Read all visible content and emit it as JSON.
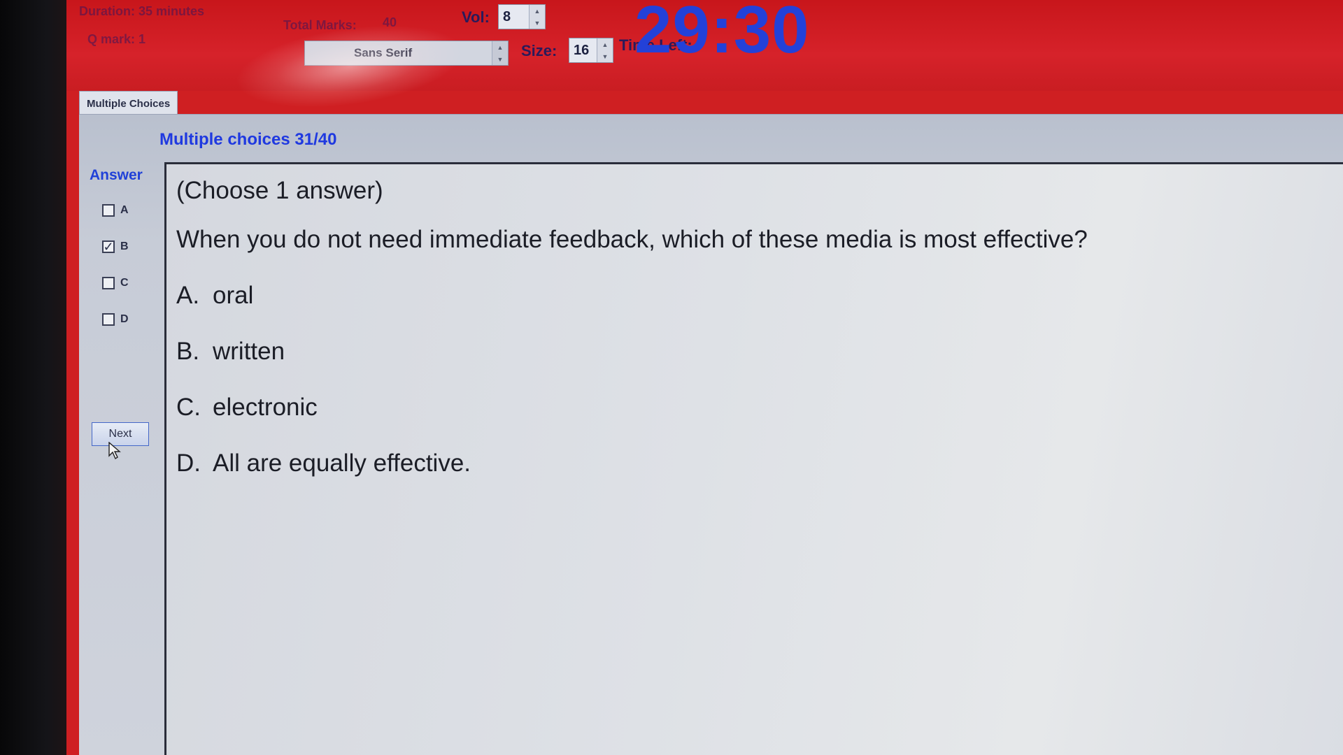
{
  "header": {
    "duration_text": "Duration: 35 minutes",
    "question_mark_text": "Q mark: 1",
    "total_marks_label": "Total Marks:",
    "total_marks_value": "40",
    "volume_label": "Vol:",
    "volume_value": "8",
    "font_value": "Sans Serif",
    "size_label": "Size:",
    "size_value": "16",
    "time_left_label": "Time Left:",
    "timer": "29:30"
  },
  "tab": {
    "label": "Multiple Choices"
  },
  "section": {
    "title": "Multiple choices 31/40"
  },
  "answer_panel": {
    "label": "Answer",
    "options": [
      {
        "letter": "A",
        "checked": false,
        "mark": ""
      },
      {
        "letter": "B",
        "checked": true,
        "mark": "✓"
      },
      {
        "letter": "C",
        "checked": false,
        "mark": ""
      },
      {
        "letter": "D",
        "checked": false,
        "mark": ""
      }
    ],
    "next_label": "Next"
  },
  "question": {
    "instruction": "(Choose 1 answer)",
    "text": "When you do not need immediate feedback, which of these media is most effective?",
    "choices": [
      {
        "letter": "A.",
        "text": "oral"
      },
      {
        "letter": "B.",
        "text": "written"
      },
      {
        "letter": "C.",
        "text": "electronic"
      },
      {
        "letter": "D.",
        "text": "All are equally effective."
      }
    ]
  },
  "colors": {
    "header_red": "#d6222a",
    "timer_blue": "#2341d8",
    "title_blue": "#1f39e0"
  }
}
